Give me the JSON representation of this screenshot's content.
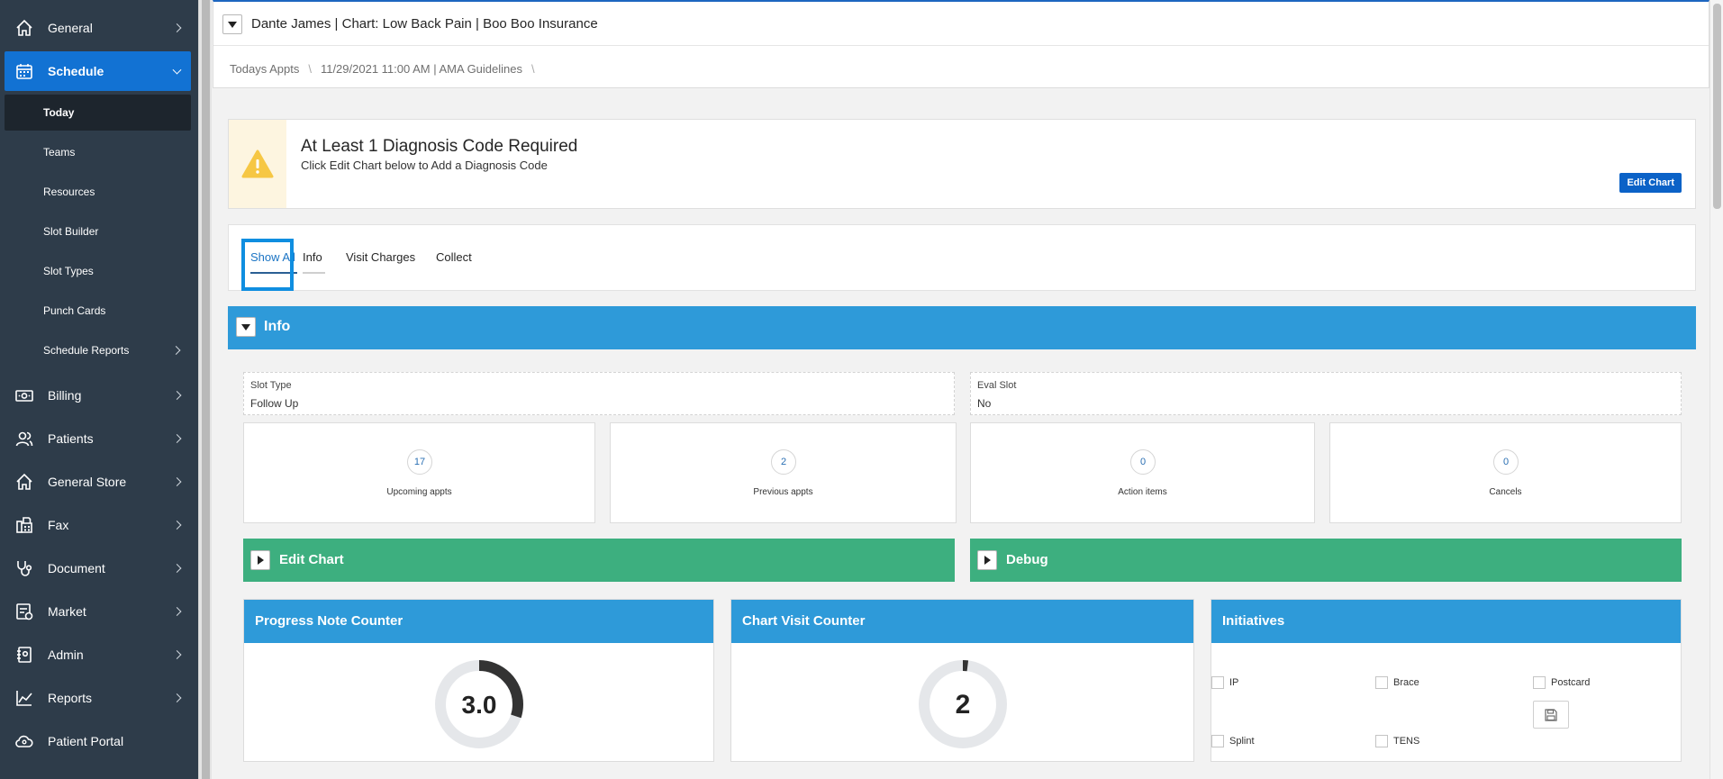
{
  "sidebar": {
    "items": [
      {
        "label": "General",
        "icon": "home-icon"
      },
      {
        "label": "Schedule",
        "icon": "calendar-icon"
      },
      {
        "label": "Billing",
        "icon": "money-icon"
      },
      {
        "label": "Patients",
        "icon": "users-icon"
      },
      {
        "label": "General Store",
        "icon": "store-icon"
      },
      {
        "label": "Fax",
        "icon": "fax-icon"
      },
      {
        "label": "Document",
        "icon": "stethoscope-icon"
      },
      {
        "label": "Market",
        "icon": "market-icon"
      },
      {
        "label": "Admin",
        "icon": "admin-icon"
      },
      {
        "label": "Reports",
        "icon": "chart-icon"
      },
      {
        "label": "Patient Portal",
        "icon": "cloud-icon"
      }
    ],
    "schedule_sub": [
      {
        "label": "Today"
      },
      {
        "label": "Teams"
      },
      {
        "label": "Resources"
      },
      {
        "label": "Slot Builder"
      },
      {
        "label": "Slot Types"
      },
      {
        "label": "Punch Cards"
      },
      {
        "label": "Schedule Reports"
      }
    ]
  },
  "header": {
    "title": "Dante James | Chart: Low Back Pain | Boo Boo Insurance",
    "breadcrumb": [
      "Todays Appts",
      "11/29/2021 11:00 AM | AMA Guidelines"
    ]
  },
  "alert": {
    "title": "At Least 1 Diagnosis Code Required",
    "message": "Click Edit Chart below to Add a Diagnosis Code",
    "button": "Edit Chart"
  },
  "tabs": [
    "Show All",
    "Info",
    "Visit Charges",
    "Collect"
  ],
  "info_section": {
    "title": "Info",
    "slot_type_label": "Slot Type",
    "slot_type_value": "Follow Up",
    "eval_slot_label": "Eval Slot",
    "eval_slot_value": "No"
  },
  "stats": [
    {
      "value": "17",
      "label": "Upcoming appts"
    },
    {
      "value": "2",
      "label": "Previous appts"
    },
    {
      "value": "0",
      "label": "Action items"
    },
    {
      "value": "0",
      "label": "Cancels"
    }
  ],
  "panels": {
    "edit_chart": "Edit Chart",
    "debug": "Debug"
  },
  "widgets": {
    "progress_note": {
      "title": "Progress Note Counter",
      "value": "3.0",
      "fill_fraction": 0.3
    },
    "chart_visit": {
      "title": "Chart Visit Counter",
      "value": "2",
      "fill_fraction": 0.02
    },
    "initiatives": {
      "title": "Initiatives",
      "options": [
        "IP",
        "Brace",
        "Postcard",
        "Splint",
        "TENS"
      ]
    }
  },
  "colors": {
    "sidebar_bg": "#2e3c4a",
    "active_nav": "#1272d3",
    "section_blue": "#2e9ad9",
    "section_green": "#3daf7f",
    "warning_yellow": "#f6c744"
  }
}
